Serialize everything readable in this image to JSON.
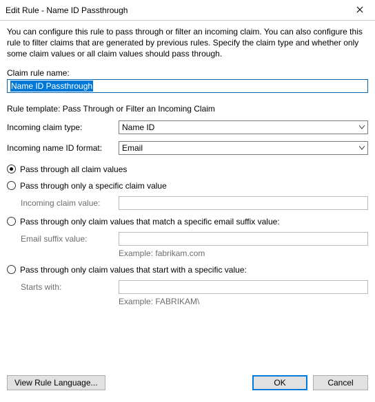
{
  "window": {
    "title": "Edit Rule - Name ID Passthrough"
  },
  "content": {
    "description": "You can configure this rule to pass through or filter an incoming claim. You can also configure this rule to filter claims that are generated by previous rules. Specify the claim type and whether only some claim values or all claim values should pass through.",
    "rule_name_label": "Claim rule name:",
    "rule_name_value": "Name ID Passthrough",
    "template_line_prefix": "Rule template: ",
    "template_name": "Pass Through or Filter an Incoming Claim",
    "incoming_type_label": "Incoming claim type:",
    "incoming_type_value": "Name ID",
    "incoming_format_label": "Incoming name ID format:",
    "incoming_format_value": "Email",
    "radios": {
      "all": "Pass through all claim values",
      "specific": "Pass through only a specific claim value",
      "specific_sub_label": "Incoming claim value:",
      "suffix": "Pass through only claim values that match a specific email suffix value:",
      "suffix_sub_label": "Email suffix value:",
      "suffix_example": "Example: fabrikam.com",
      "starts": "Pass through only claim values that start with a specific value:",
      "starts_sub_label": "Starts with:",
      "starts_example": "Example: FABRIKAM\\"
    }
  },
  "footer": {
    "view_language": "View Rule Language...",
    "ok": "OK",
    "cancel": "Cancel"
  }
}
